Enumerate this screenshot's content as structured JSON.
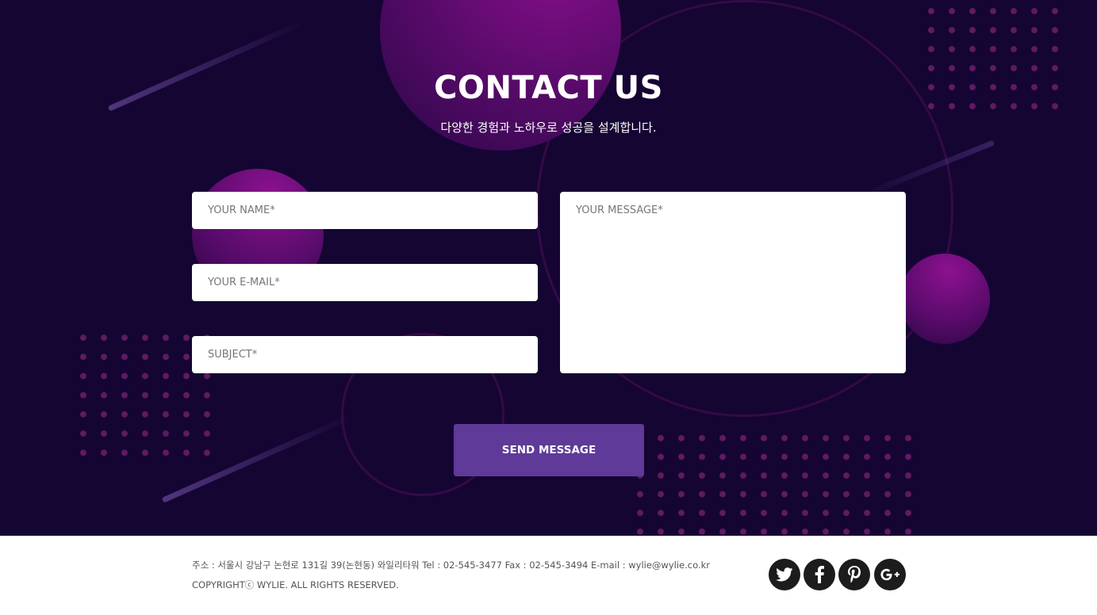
{
  "contact": {
    "title": "CONTACT US",
    "subtitle": "다양한 경험과 노하우로 성공을 설계합니다.",
    "form": {
      "name_placeholder": "YOUR NAME*",
      "email_placeholder": "YOUR E-MAIL*",
      "subject_placeholder": "SUBJECT*",
      "message_placeholder": "YOUR MESSAGE*",
      "send_label": "SEND MESSAGE"
    }
  },
  "footer": {
    "address": "주소 : 서울시 강남구 논현로 131길 39(논현동) 와일리타워 Tel : 02-545-3477 Fax : 02-545-3494 E-mail : wylie@wylie.co.kr",
    "copyright": "COPYRIGHTⓒ WYLIE. ALL RIGHTS RESERVED.",
    "social": [
      {
        "icon": "twitter-icon"
      },
      {
        "icon": "facebook-icon"
      },
      {
        "icon": "pinterest-icon"
      },
      {
        "icon": "google-plus-icon"
      }
    ]
  },
  "colors": {
    "section_background": "#150533",
    "button_background": "#5f3a98",
    "sphere_purple": "#8a0f8c",
    "dot_color": "#5f1a63",
    "social_icon_background": "#1c1c1c"
  }
}
